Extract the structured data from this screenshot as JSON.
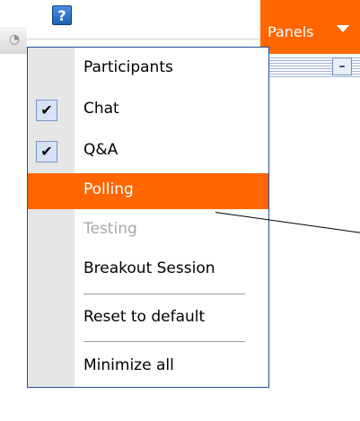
{
  "toolbar": {
    "help_label": "?",
    "panels_label": "Panels",
    "minimize_label": "–"
  },
  "menu": {
    "items": [
      {
        "label": "Participants",
        "checked": false,
        "state": "normal"
      },
      {
        "label": "Chat",
        "checked": true,
        "state": "normal"
      },
      {
        "label": "Q&A",
        "checked": true,
        "state": "normal"
      },
      {
        "label": "Polling",
        "checked": false,
        "state": "highlighted"
      },
      {
        "label": "Testing",
        "checked": false,
        "state": "disabled"
      },
      {
        "label": "Breakout Session",
        "checked": false,
        "state": "normal"
      },
      {
        "label": "Reset to default",
        "checked": false,
        "state": "normal"
      },
      {
        "label": "Minimize all",
        "checked": false,
        "state": "normal"
      }
    ],
    "check_glyph": "✔"
  },
  "colors": {
    "accent": "#ff6600",
    "menu_border": "#1e4f9c",
    "gutter": "#e6e6e6",
    "disabled_text": "#a8a8a8"
  }
}
